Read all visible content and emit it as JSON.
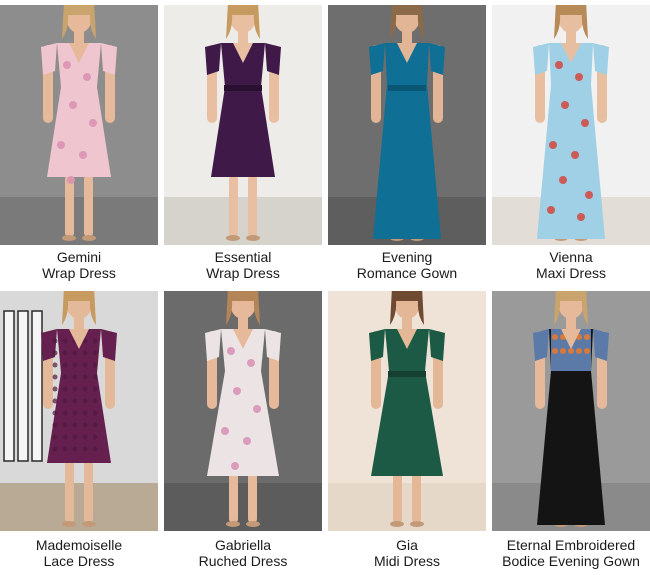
{
  "products": [
    {
      "line1": "Gemini",
      "line2": "Wrap Dress",
      "bg": "#8d8d8d",
      "floor": "#7a7a7a",
      "dress": "#efc6cf",
      "accent": "#d88fb0",
      "style": "wrap-short",
      "skin": "#e6b99a",
      "hair": "#c9a46c"
    },
    {
      "line1": "Essential",
      "line2": "Wrap Dress",
      "bg": "#eeece8",
      "floor": "#d6d3cd",
      "dress": "#3f1948",
      "accent": "#2b0f33",
      "style": "wrap-short",
      "skin": "#e8bfa0",
      "hair": "#c79a5f"
    },
    {
      "line1": "Evening",
      "line2": "Romance Gown",
      "bg": "#6e6e6e",
      "floor": "#5e5e5e",
      "dress": "#0f6f95",
      "accent": "#0a5675",
      "style": "gown",
      "skin": "#e2b596",
      "hair": "#8a6a48"
    },
    {
      "line1": "Vienna",
      "line2": "Maxi Dress",
      "bg": "#f1f1f1",
      "floor": "#e2ddd6",
      "dress": "#9fd0e6",
      "accent": "#d4473d",
      "style": "maxi-flare",
      "skin": "#e8bea1",
      "hair": "#b88a57"
    },
    {
      "line1": "Mademoiselle",
      "line2": "Lace Dress",
      "bg": "#d9d9d9",
      "floor": "#b9aa96",
      "dress": "#66204f",
      "accent": "#4e1a3e",
      "style": "lace",
      "skin": "#e4b999",
      "hair": "#c79a5f"
    },
    {
      "line1": "Gabriella",
      "line2": "Ruched Dress",
      "bg": "#6b6b6b",
      "floor": "#5c5c5c",
      "dress": "#ece4e4",
      "accent": "#d88fb5",
      "style": "floral",
      "skin": "#e6b99a",
      "hair": "#b48556"
    },
    {
      "line1": "Gia",
      "line2": "Midi Dress",
      "bg": "#efe3d7",
      "floor": "#e6d8c9",
      "dress": "#1d5a45",
      "accent": "#143f31",
      "style": "midi",
      "skin": "#e4b797",
      "hair": "#6e4a33"
    },
    {
      "line1": "Eternal Embroidered",
      "line2": "Bodice Evening Gown",
      "bg": "#9a9a9a",
      "floor": "#8a8a8a",
      "dress": "#141414",
      "accent": "#5b7aa8",
      "style": "bodice",
      "skin": "#e6b99a",
      "hair": "#c9a46c"
    }
  ]
}
